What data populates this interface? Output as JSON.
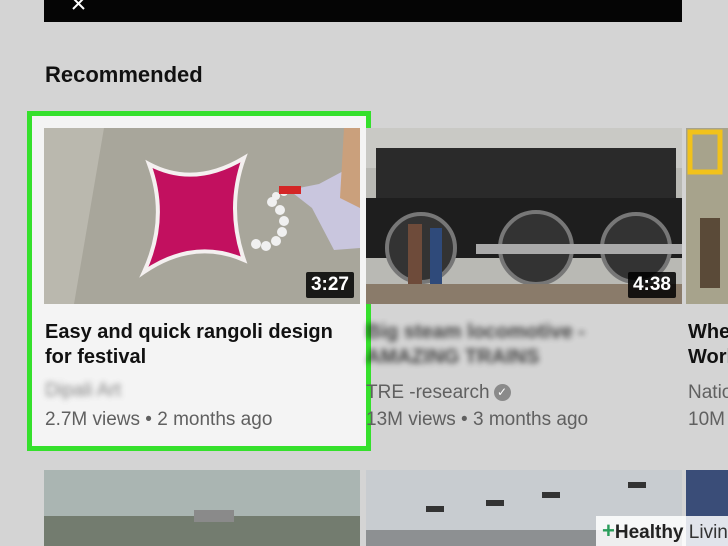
{
  "section": {
    "title": "Recommended"
  },
  "videos": [
    {
      "title": "Easy and quick rangoli design for festival",
      "channel": "Dipali Art",
      "views": "2.7M views",
      "age": "2 months ago",
      "duration": "3:27"
    },
    {
      "title": "Big steam locomotive - AMAZING TRAINS",
      "channel": "TRE -research",
      "views": "13M views",
      "age": "3 months ago",
      "duration": "4:38"
    },
    {
      "title_line1": "Whe",
      "title_line2": "Worl",
      "channel": "Natio",
      "views": "10M"
    }
  ],
  "watermark": {
    "brand_bold": "Healthy",
    "brand_rest": " Living"
  },
  "colors": {
    "highlight": "#35e02c",
    "background": "#d4d4d4",
    "duration_bg": "#000000"
  },
  "icons": {
    "mute": "muted-speaker-icon",
    "verified": "verified-check-icon",
    "watermark": "health-plus-icon"
  }
}
